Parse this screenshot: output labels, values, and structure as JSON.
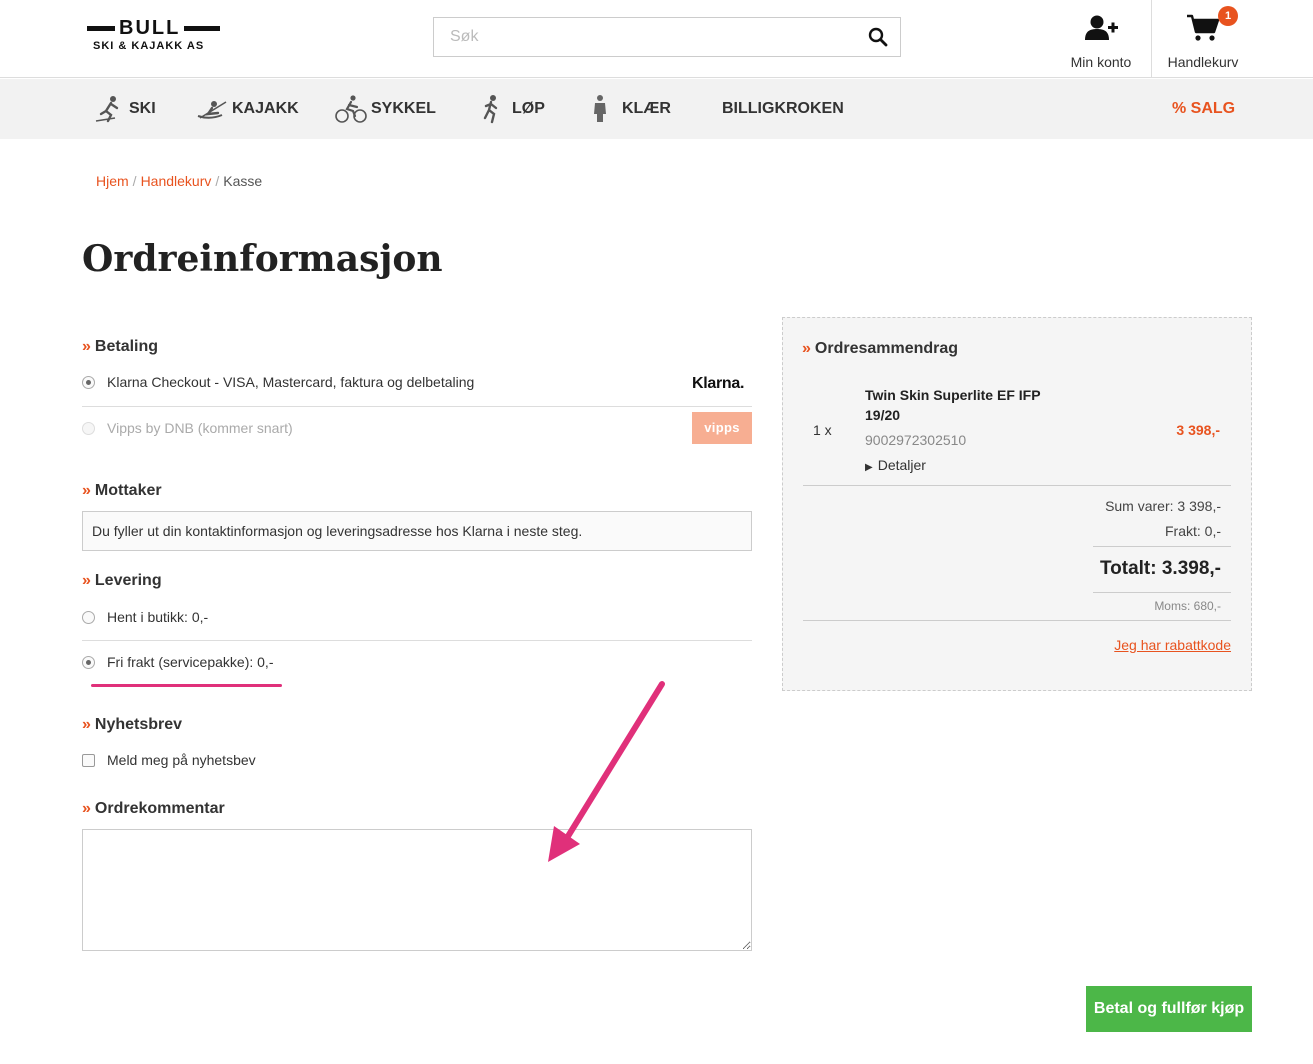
{
  "header": {
    "logo_main": "BULL",
    "logo_sub": "SKI & KAJAKK AS",
    "search_placeholder": "Søk",
    "account_label": "Min konto",
    "cart_label": "Handlekurv",
    "cart_count": "1"
  },
  "nav": {
    "items": [
      {
        "label": "SKI",
        "icon": "skier-icon"
      },
      {
        "label": "KAJAKK",
        "icon": "kayak-icon"
      },
      {
        "label": "SYKKEL",
        "icon": "cyclist-icon"
      },
      {
        "label": "LØP",
        "icon": "runner-icon"
      },
      {
        "label": "KLÆR",
        "icon": "clothing-icon"
      },
      {
        "label": "BILLIGKROKEN"
      },
      {
        "label": "% SALG"
      }
    ]
  },
  "breadcrumb": {
    "items": [
      "Hjem",
      "Handlekurv",
      "Kasse"
    ]
  },
  "page": {
    "title": "Ordreinformasjon"
  },
  "payment": {
    "heading": "Betaling",
    "options": [
      {
        "label": "Klarna Checkout - VISA, Mastercard, faktura og delbetaling",
        "logo": "Klarna.",
        "selected": true
      },
      {
        "label": "Vipps by DNB (kommer snart)",
        "logo": "vipps",
        "disabled": true
      }
    ]
  },
  "recipient": {
    "heading": "Mottaker",
    "info": "Du fyller ut din kontaktinformasjon og leveringsadresse hos Klarna i neste steg."
  },
  "delivery": {
    "heading": "Levering",
    "options": [
      {
        "label": "Hent i butikk: 0,-",
        "selected": false
      },
      {
        "label": "Fri frakt (servicepakke): 0,-",
        "selected": true
      }
    ]
  },
  "newsletter": {
    "heading": "Nyhetsbrev",
    "checkbox_label": "Meld meg på nyhetsbev"
  },
  "comment": {
    "heading": "Ordrekommentar"
  },
  "summary": {
    "heading": "Ordresammendrag",
    "item": {
      "qty": "1 x",
      "name": "Twin Skin Superlite EF IFP 19/20",
      "sku": "9002972302510",
      "details": "Detaljer",
      "price": "3 398,-"
    },
    "sum_varer": "Sum varer:  3 398,-",
    "frakt": "Frakt:  0,-",
    "total": "Totalt:  3.398,-",
    "moms": "Moms:  680,-",
    "discount_link": "Jeg har rabattkode"
  },
  "actions": {
    "pay_button": "Betal og fullfør kjøp"
  },
  "colors": {
    "accent": "#e8531f",
    "pay_button": "#4cb748",
    "annotation": "#e0307a"
  }
}
